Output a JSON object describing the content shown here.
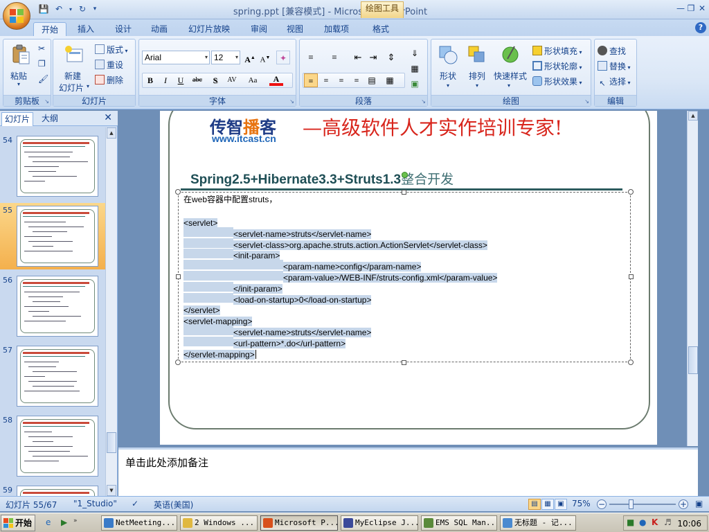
{
  "window": {
    "title": "spring.ppt [兼容模式] - Microsoft PowerPoint",
    "context_tab_title": "绘图工具"
  },
  "ribbon_tabs": [
    "开始",
    "插入",
    "设计",
    "动画",
    "幻灯片放映",
    "审阅",
    "视图",
    "加载项",
    "格式"
  ],
  "ribbon": {
    "clipboard": {
      "label": "剪贴板",
      "paste": "粘贴"
    },
    "slides": {
      "label": "幻灯片",
      "new_slide": "新建",
      "new_slide2": "幻灯片",
      "layout": "版式",
      "reset": "重设",
      "delete": "删除"
    },
    "font": {
      "label": "字体",
      "font_name": "Arial",
      "font_size": "12"
    },
    "paragraph": {
      "label": "段落"
    },
    "drawing": {
      "label": "绘图",
      "shapes": "形状",
      "arrange": "排列",
      "quick_styles": "快速样式",
      "shape_fill": "形状填充",
      "shape_outline": "形状轮廓",
      "shape_effects": "形状效果"
    },
    "editing": {
      "label": "编辑",
      "find": "查找",
      "replace": "替换",
      "select": "选择"
    }
  },
  "left_pane": {
    "tabs": [
      "幻灯片",
      "大纲"
    ],
    "slide_numbers": [
      "54",
      "55",
      "56",
      "57",
      "58",
      "59"
    ],
    "selected_index": 1
  },
  "slide": {
    "brand_part1": "传智",
    "brand_part2": "播",
    "brand_part3": "客",
    "brand_url": "www.itcast.cn",
    "slogan": "—高级软件人才实作培训专家!",
    "title_en": "Spring2.5+Hibernate3.3+Struts1.3",
    "title_cn": "整合开发",
    "intro": "在web容器中配置struts，",
    "code_lines": [
      {
        "indent": 0,
        "text": "<servlet>"
      },
      {
        "indent": 1,
        "text": "<servlet-name>struts</servlet-name>"
      },
      {
        "indent": 1,
        "text": "<servlet-class>org.apache.struts.action.ActionServlet</servlet-class>"
      },
      {
        "indent": 1,
        "text": "<init-param>"
      },
      {
        "indent": 2,
        "text": "<param-name>config</param-name>"
      },
      {
        "indent": 2,
        "text": "<param-value>/WEB-INF/struts-config.xml</param-value>"
      },
      {
        "indent": 1,
        "text": "</init-param>"
      },
      {
        "indent": 1,
        "text": "<load-on-startup>0</load-on-startup>"
      },
      {
        "indent": 0,
        "text": "</servlet>"
      },
      {
        "indent": 0,
        "text": "<servlet-mapping>"
      },
      {
        "indent": 1,
        "text": "<servlet-name>struts</servlet-name>"
      },
      {
        "indent": 1,
        "text": "<url-pattern>*.do</url-pattern>"
      },
      {
        "indent": 0,
        "text": "</servlet-mapping>"
      }
    ]
  },
  "notes": {
    "placeholder": "单击此处添加备注"
  },
  "status": {
    "slide_info": "幻灯片 55/67",
    "theme": "\"1_Studio\"",
    "language": "英语(美国)",
    "zoom": "75%",
    "zoom_fraction": 0.32
  },
  "taskbar": {
    "start": "开始",
    "items": [
      {
        "label": "NetMeeting...",
        "color": "#3a7bc8"
      },
      {
        "label": "2 Windows ...",
        "color": "#e0b840"
      },
      {
        "label": "Microsoft P...",
        "color": "#d8501c"
      },
      {
        "label": "MyEclipse J...",
        "color": "#3b4a9a"
      },
      {
        "label": "EMS SQL Man...",
        "color": "#5a8a3a"
      },
      {
        "label": "无标题 - 记...",
        "color": "#4a8ad0"
      }
    ],
    "active_index": 2,
    "clock": "10:06"
  }
}
